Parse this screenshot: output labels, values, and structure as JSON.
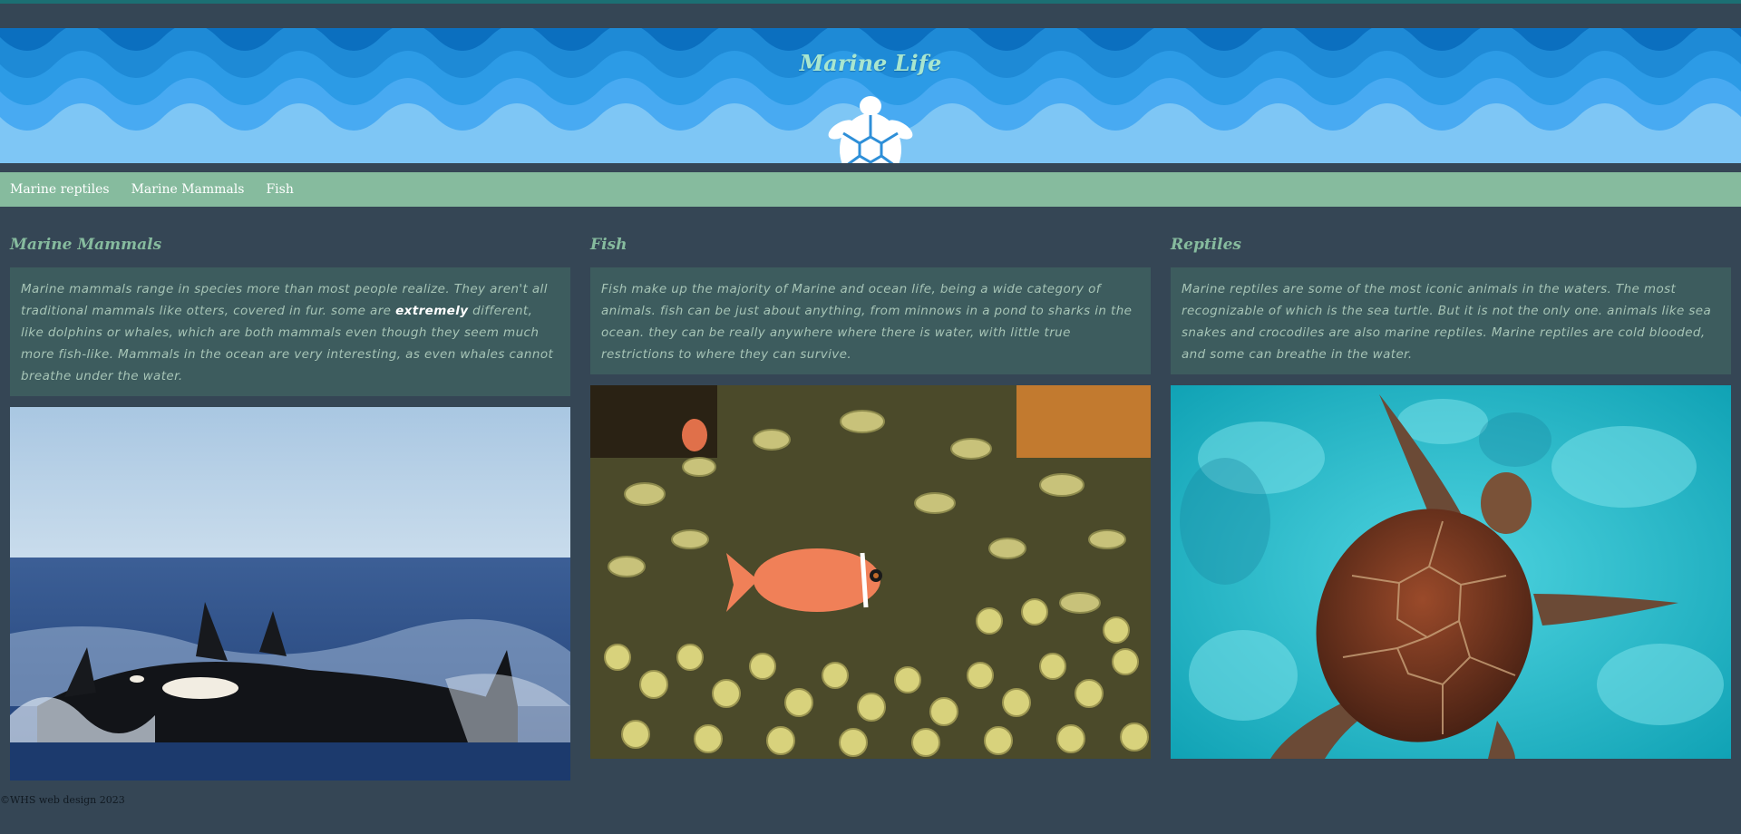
{
  "header": {
    "title": "Marine Life",
    "logo_icon": "turtle-icon"
  },
  "nav": {
    "items": [
      {
        "label": "Marine reptiles"
      },
      {
        "label": "Marine Mammals"
      },
      {
        "label": "Fish"
      }
    ]
  },
  "sections": [
    {
      "heading": "Marine Mammals",
      "text_before": "Marine mammals range in species more than most people realize. They aren't all traditional mammals like otters, covered in fur. some are ",
      "emphasis": "extremely",
      "text_after": " different, like dolphins or whales, which are both mammals even though they seem much more fish-like. Mammals in the ocean are very interesting, as even whales cannot breathe under the water.",
      "image": "orca-whales-photo"
    },
    {
      "heading": "Fish",
      "text": "Fish make up the majority of Marine and ocean life, being a wide category of animals. fish can be just about anything, from minnows in a pond to sharks in the ocean. they can be really anywhere where there is water, with little true restrictions to where they can survive.",
      "image": "clownfish-anemone-photo"
    },
    {
      "heading": "Reptiles",
      "text": "Marine reptiles are some of the most iconic animals in the waters. The most recognizable of which is the sea turtle. But it is not the only one. animals like sea snakes and crocodiles are also marine reptiles. Marine reptiles are cold blooded, and some can breathe in the water.",
      "image": "sea-turtle-photo"
    }
  ],
  "footer": {
    "text": "©WHS web design 2023"
  },
  "colors": {
    "background": "#354655",
    "nav": "#86bb9e",
    "card": "#3d5c5e",
    "heading": "#86bb9e",
    "title": "#a8e6cf"
  }
}
